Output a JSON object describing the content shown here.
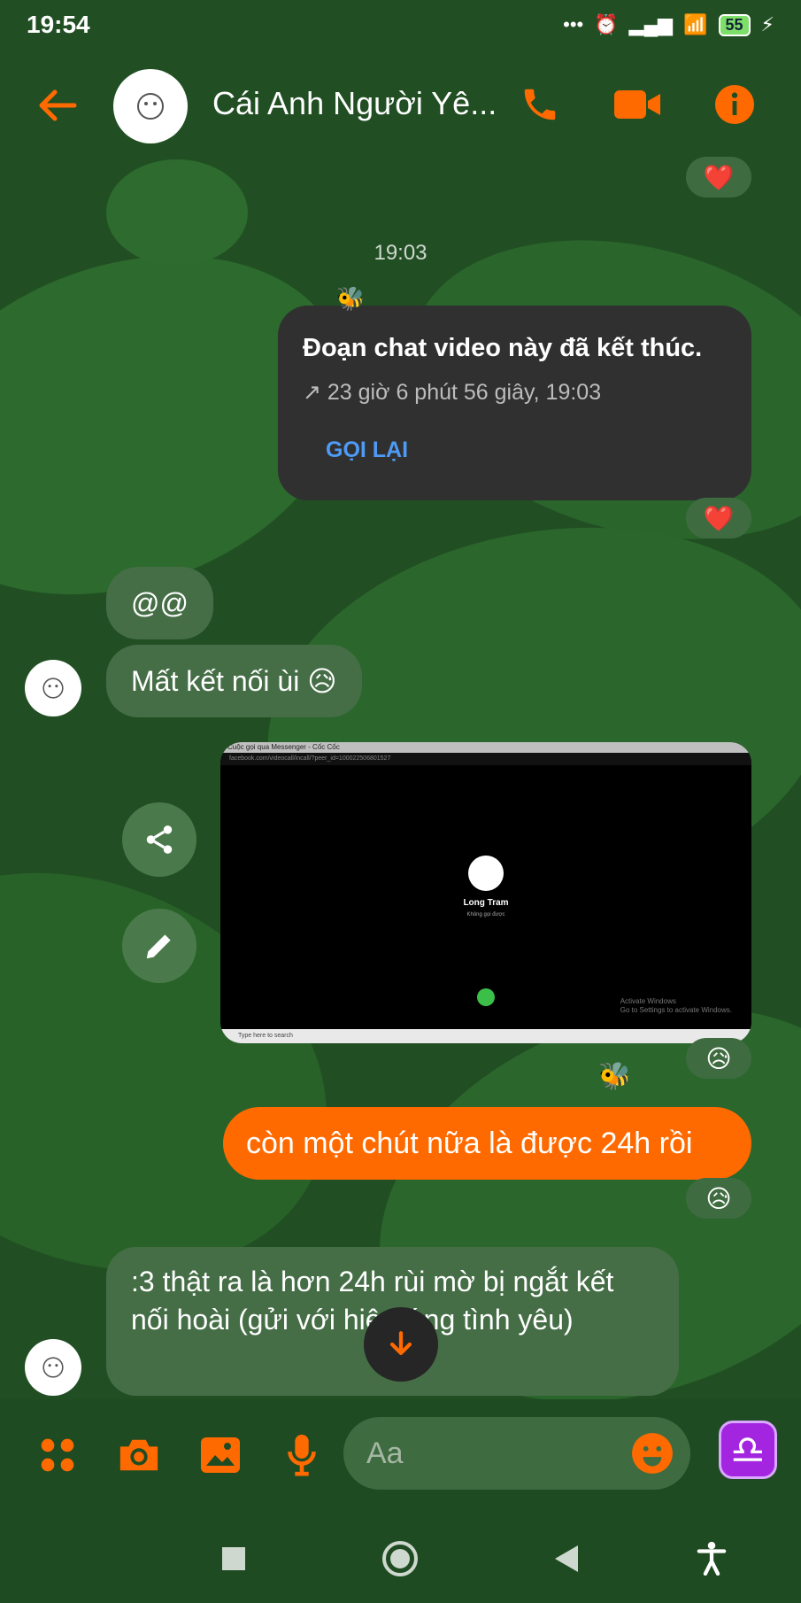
{
  "status": {
    "time": "19:54",
    "battery": "55"
  },
  "header": {
    "title": "Cái Anh Người Yê..."
  },
  "messages": {
    "timestamp": "19:03",
    "call_card": {
      "title": "Đoạn chat video này đã kết thúc.",
      "detail": "↗ 23 giờ 6 phút 56 giây, 19:03",
      "button": "GỌI LẠI"
    },
    "incoming_1": "@@",
    "incoming_2": "Mất kết nối ùi 😥",
    "screenshot": {
      "window_title": "Cuộc gọi qua Messenger - Cốc Cốc",
      "url": "facebook.com/videocall/incall/?peer_id=100022506801527",
      "caller_name": "Long Tram",
      "caller_status": "Không gọi được",
      "activate_line1": "Activate Windows",
      "activate_line2": "Go to Settings to activate Windows.",
      "taskbar_search": "Type here to search"
    },
    "outgoing_1": "còn một chút nữa là được 24h rồi",
    "incoming_3": ":3 thật ra là hơn 24h rùi mờ bị ngắt kết nối hoài (gửi với hiệu ứng tình yêu)"
  },
  "reactions": {
    "heart": "❤️",
    "cry": "😥"
  },
  "composer": {
    "placeholder": "Aa",
    "sticker": "♎"
  },
  "colors": {
    "accent": "#ff6a00",
    "bubble_in": "#456e46",
    "card": "#303030",
    "link": "#4e9af5"
  }
}
